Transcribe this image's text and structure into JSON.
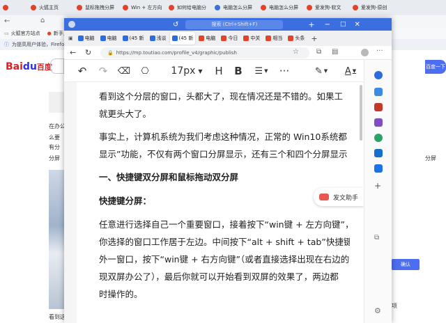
{
  "back_browser": {
    "tabs": [
      {
        "label": "",
        "color": "#e2432b"
      },
      {
        "label": "火狐主页",
        "color": "#e2432b"
      },
      {
        "label": "鼠标拖拽分屏",
        "color": "#e2432b"
      },
      {
        "label": "Win + 左方向",
        "color": "#e2432b"
      },
      {
        "label": "如何给电脑分",
        "color": "#e2432b"
      },
      {
        "label": "电脑怎么分屏",
        "color": "#3b6fe0"
      },
      {
        "label": "电脑怎么分屏",
        "color": "#e2432b"
      },
      {
        "label": "爱发狗-软文",
        "color": "#e2432b"
      },
      {
        "label": "爱发狗-原创",
        "color": "#e2432b"
      }
    ],
    "bookmarks": [
      "火狐官方站点",
      "新手上路"
    ],
    "notice": "为提高用户体验，Firefox 和",
    "baidu_logo_a": "Bai",
    "baidu_logo_b": "du",
    "baidu_logo_c": "百度",
    "side_lines": [
      "在办公",
      "么要",
      "有分",
      "分屏"
    ],
    "bottom_left": "看到这",
    "right_btn": "百度一下",
    "right_small": "确认",
    "right_label": "分屏",
    "right_items": [
      "项"
    ]
  },
  "front_browser": {
    "tabs": [
      {
        "label": "电脑",
        "color": "#2d6cdf",
        "active": false
      },
      {
        "label": "电脑",
        "color": "#2d6cdf",
        "active": false
      },
      {
        "label": "(45 新",
        "color": "#2d6cdf",
        "active": false
      },
      {
        "label": "浅谈",
        "color": "#2d6cdf",
        "active": false
      },
      {
        "label": "(45 新",
        "color": "#2d6cdf",
        "active": true
      },
      {
        "label": "电脑",
        "color": "#e2432b",
        "active": false
      },
      {
        "label": "今日",
        "color": "#e2432b",
        "active": false
      },
      {
        "label": "中关",
        "color": "#e2432b",
        "active": false
      },
      {
        "label": "相当",
        "color": "#e2432b",
        "active": false
      },
      {
        "label": "头条",
        "color": "#e2432b",
        "active": false
      }
    ],
    "search_placeholder": "搜索 (Ctrl+Shift+F)",
    "url": "https://mp.toutiao.com/profile_v4/graphic/publish",
    "font_size": "17px",
    "heading_btn": "H",
    "bold_btn": "B",
    "more_btn": "···",
    "fawen_label": "发文助手"
  },
  "article": {
    "paragraphs": [
      {
        "text": "看到这个分层的窗口，头都大了，现在情况还是不错的。如果工",
        "bold": false
      },
      {
        "text": "就更头大了。",
        "bold": false
      },
      {
        "text": "事实上，计算机系统为我们考虑这种情况，正常的 Win10系统都",
        "bold": false
      },
      {
        "text": "显示”功能，不仅有两个窗口分屏显示，还有三个和四个分屏显示",
        "bold": false
      },
      {
        "text": "一、快捷键双分屏和鼠标拖动双分屏",
        "bold": true
      },
      {
        "text": "快捷键分屏：",
        "bold": true
      },
      {
        "text": "任意进行选择自己一个重要窗口，接着按下“win键 + 左方向键”，",
        "bold": false
      },
      {
        "text": "你选择的窗口工作居于左边。中间按下“alt + shift + tab”快捷键”，",
        "bold": false
      },
      {
        "text": "外一窗口，按下“win键 + 右方向键”（或者直接选择出现在右边的",
        "bold": false
      },
      {
        "text": "现双屏办公了），最后你就可以开始看到双屏的效果了，两边都",
        "bold": false
      },
      {
        "text": "时操作的。",
        "bold": false
      }
    ]
  }
}
